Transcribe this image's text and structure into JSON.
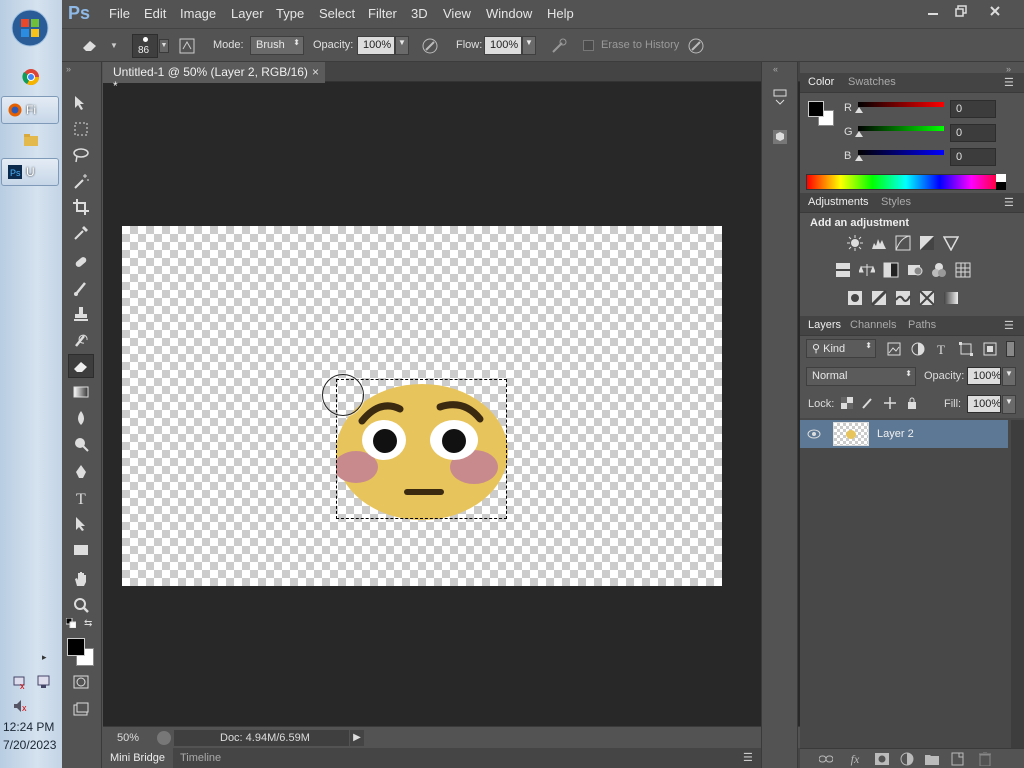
{
  "taskbar": {
    "items": [
      {
        "label": "Fi"
      },
      {
        "label": "U"
      }
    ],
    "time": "12:24 PM",
    "date": "7/20/2023"
  },
  "app": {
    "logo": "Ps"
  },
  "menu": [
    "File",
    "Edit",
    "Image",
    "Layer",
    "Type",
    "Select",
    "Filter",
    "3D",
    "View",
    "Window",
    "Help"
  ],
  "options": {
    "brush_size": "86",
    "mode_label": "Mode:",
    "mode_value": "Brush",
    "opacity_label": "Opacity:",
    "opacity_value": "100%",
    "flow_label": "Flow:",
    "flow_value": "100%",
    "erase_history_label": "Erase to History"
  },
  "document": {
    "tab_title": "Untitled-1 @ 50% (Layer 2, RGB/16) *",
    "close": "×",
    "zoom": "50%",
    "doc_info": "Doc: 4.94M/6.59M"
  },
  "bottom_tabs": [
    "Mini Bridge",
    "Timeline"
  ],
  "color_panel": {
    "tabs": [
      "Color",
      "Swatches"
    ],
    "r_label": "R",
    "g_label": "G",
    "b_label": "B",
    "r_value": "0",
    "g_value": "0",
    "b_value": "0"
  },
  "adjustments_panel": {
    "tabs": [
      "Adjustments",
      "Styles"
    ],
    "heading": "Add an adjustment"
  },
  "layers_panel": {
    "tabs": [
      "Layers",
      "Channels",
      "Paths"
    ],
    "filter_kind": "Kind",
    "blend_mode": "Normal",
    "opacity_label": "Opacity:",
    "opacity_value": "100%",
    "lock_label": "Lock:",
    "fill_label": "Fill:",
    "fill_value": "100%",
    "layers": [
      {
        "name": "Layer 2"
      }
    ]
  },
  "colors": {
    "panel_bg": "#535353",
    "selected_layer": "#5d7895",
    "emoji_face": "#e8c45c"
  }
}
